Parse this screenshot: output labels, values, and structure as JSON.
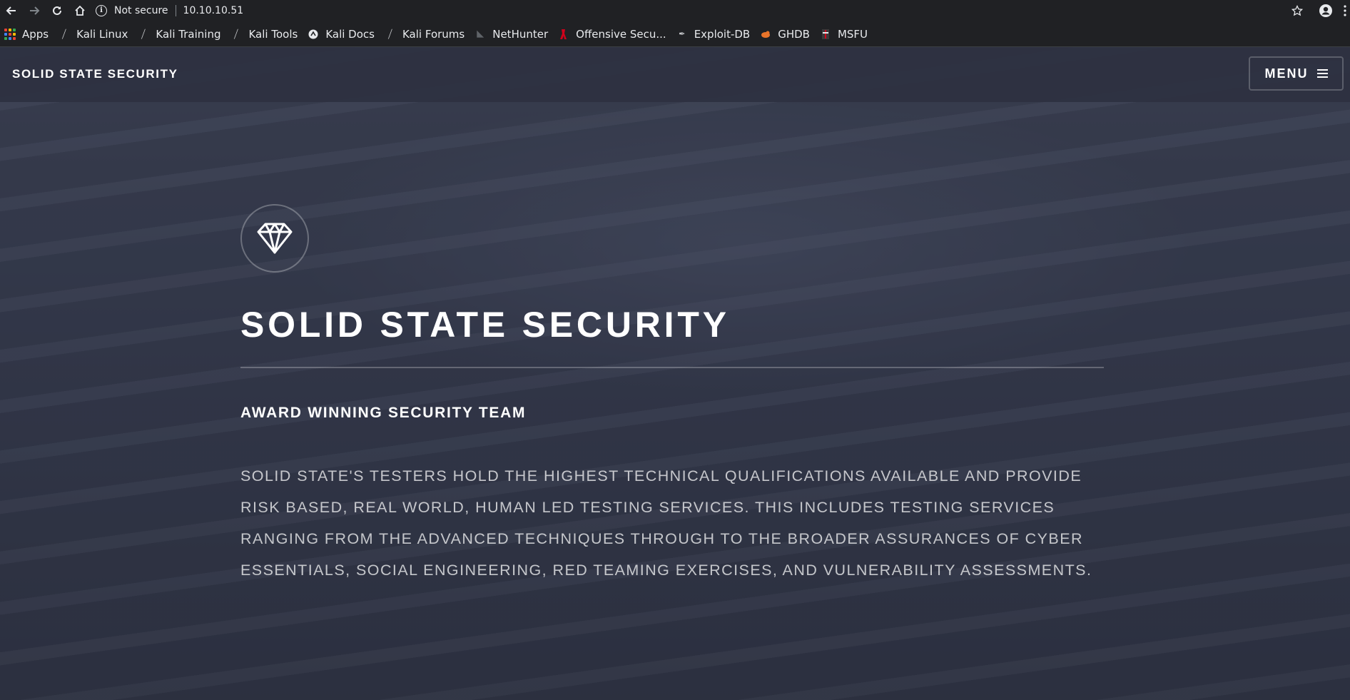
{
  "browser": {
    "security_label": "Not secure",
    "url": "10.10.10.51",
    "bookmarks": [
      {
        "label": "Apps",
        "icon": "apps-grid-icon"
      },
      {
        "label": "Kali Linux",
        "icon": "kali-dragon-icon"
      },
      {
        "label": "Kali Training",
        "icon": "kali-dragon-icon"
      },
      {
        "label": "Kali Tools",
        "icon": "kali-dragon-icon"
      },
      {
        "label": "Kali Docs",
        "icon": "kali-docs-icon"
      },
      {
        "label": "Kali Forums",
        "icon": "kali-dragon-icon"
      },
      {
        "label": "NetHunter",
        "icon": "nethunter-icon"
      },
      {
        "label": "Offensive Secu...",
        "icon": "offsec-icon"
      },
      {
        "label": "Exploit-DB",
        "icon": "exploit-db-icon"
      },
      {
        "label": "GHDB",
        "icon": "ghdb-icon"
      },
      {
        "label": "MSFU",
        "icon": "msfu-icon"
      }
    ]
  },
  "site": {
    "logo_text": "SOLID STATE SECURITY",
    "menu_label": "MENU"
  },
  "hero": {
    "title": "SOLID STATE SECURITY",
    "subtitle": "AWARD WINNING SECURITY TEAM",
    "description": "SOLID STATE'S TESTERS HOLD THE HIGHEST TECHNICAL QUALIFICATIONS AVAILABLE AND PROVIDE RISK BASED, REAL WORLD, HUMAN LED TESTING SERVICES. THIS INCLUDES TESTING SERVICES RANGING FROM THE ADVANCED TECHNIQUES THROUGH TO THE BROADER ASSURANCES OF CYBER ESSENTIALS, SOCIAL ENGINEERING, RED TEAMING EXERCISES, AND VULNERABILITY ASSESSMENTS."
  },
  "colors": {
    "chrome_bg": "#202124",
    "page_bg": "#2e3141",
    "text": "#ffffff",
    "offsec_red": "#d0021b",
    "ghdb_orange": "#e8742a"
  }
}
